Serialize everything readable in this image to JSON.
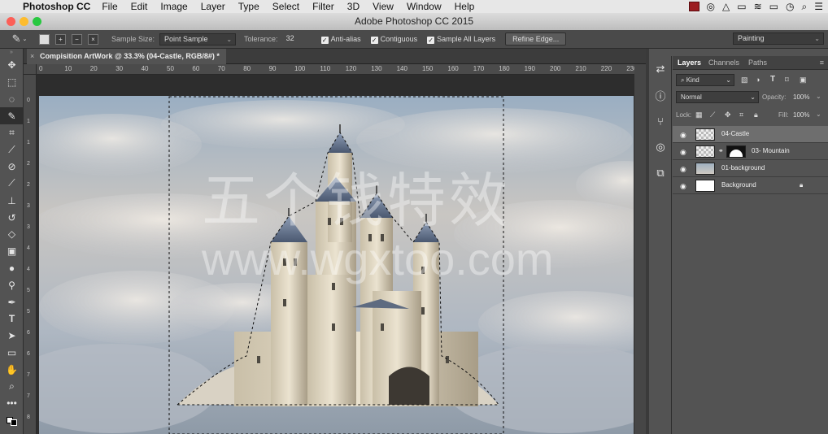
{
  "menubar": {
    "app_name": "Photoshop CC",
    "items": [
      "File",
      "Edit",
      "Image",
      "Layer",
      "Type",
      "Select",
      "Filter",
      "3D",
      "View",
      "Window",
      "Help"
    ]
  },
  "window": {
    "title": "Adobe Photoshop CC 2015"
  },
  "options": {
    "sample_size_label": "Sample Size:",
    "sample_size_value": "Point Sample",
    "tolerance_label": "Tolerance:",
    "tolerance_value": "32",
    "anti_alias": "Anti-alias",
    "contiguous": "Contiguous",
    "sample_all_layers": "Sample All Layers",
    "refine_edge": "Refine Edge...",
    "workspace": "Painting"
  },
  "document": {
    "tab_title": "Compisition ArtWork @ 33.3% (04-Castle, RGB/8#) *"
  },
  "ruler": {
    "h": [
      "0",
      "10",
      "20",
      "30",
      "40",
      "50",
      "60",
      "70",
      "80",
      "90",
      "100",
      "110",
      "120",
      "130",
      "140",
      "150",
      "160",
      "170",
      "180",
      "190",
      "200",
      "210",
      "220",
      "230"
    ],
    "v": [
      "0",
      "1",
      "1",
      "2",
      "2",
      "3",
      "3",
      "4",
      "4",
      "5",
      "5",
      "6",
      "6",
      "7",
      "7",
      "8"
    ]
  },
  "watermark": {
    "line1": "五个钱特效",
    "line2": "www.wgxtoo.com"
  },
  "layers_panel": {
    "tabs": [
      "Layers",
      "Channels",
      "Paths"
    ],
    "kind": "Kind",
    "blend_mode": "Normal",
    "opacity_label": "Opacity:",
    "opacity_value": "100%",
    "lock_label": "Lock:",
    "fill_label": "Fill:",
    "fill_value": "100%",
    "layers": [
      {
        "name": "04-Castle"
      },
      {
        "name": "03- Mountain"
      },
      {
        "name": "01-background"
      },
      {
        "name": "Background"
      }
    ]
  },
  "colors": {
    "accent": "#6e6e6e",
    "panel": "#535353",
    "menubar": "#e7e7e7"
  }
}
